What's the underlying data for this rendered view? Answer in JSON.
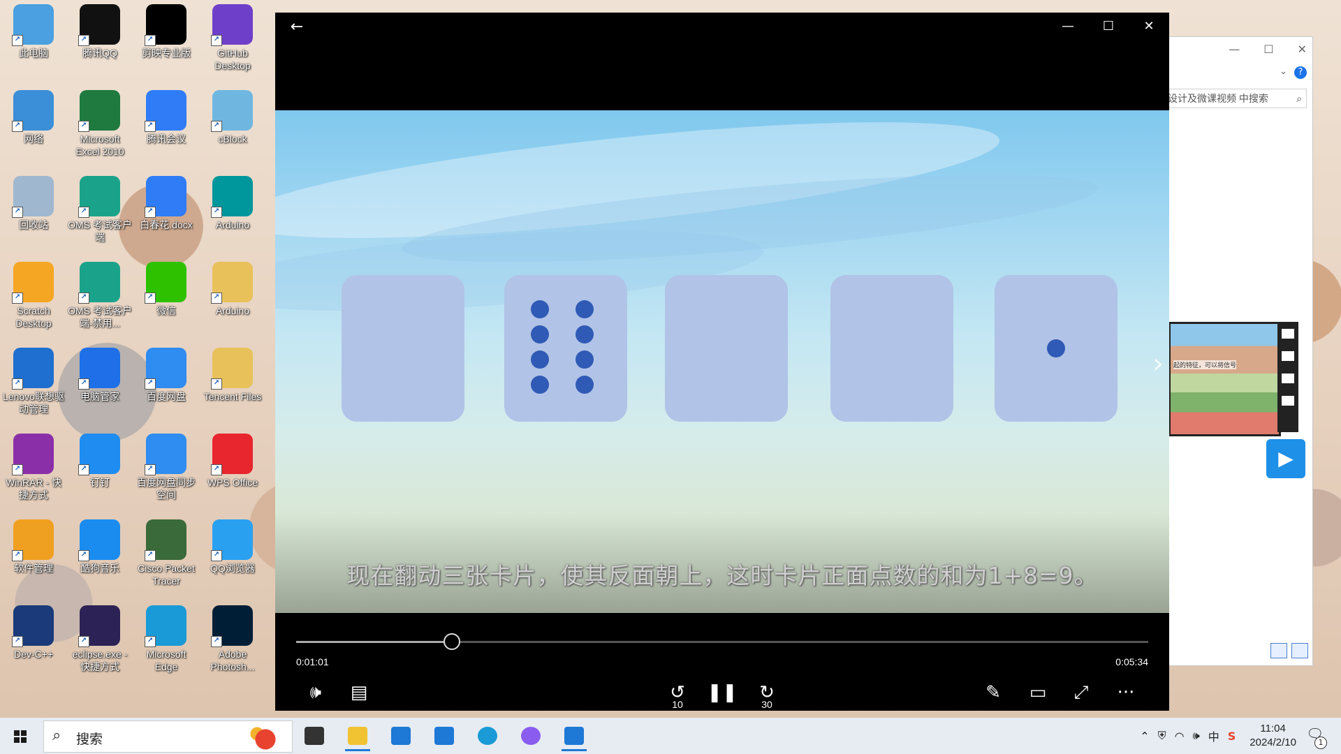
{
  "desktop": {
    "icons": [
      {
        "label": "此电脑",
        "icon": "computer-icon",
        "color": "#4aa0e0"
      },
      {
        "label": "腾讯QQ",
        "icon": "qq-icon",
        "color": "#111111"
      },
      {
        "label": "剪映专业版",
        "icon": "capcut-icon",
        "color": "#000000"
      },
      {
        "label": "GitHub Desktop",
        "icon": "github-icon",
        "color": "#6e40c9"
      },
      {
        "label": "网络",
        "icon": "network-icon",
        "color": "#3a8fd8"
      },
      {
        "label": "Microsoft Excel 2010",
        "icon": "excel-icon",
        "color": "#1f7a3f"
      },
      {
        "label": "腾讯会议",
        "icon": "tencent-meeting-icon",
        "color": "#2f7cf6"
      },
      {
        "label": "cBlock",
        "icon": "cblock-icon",
        "color": "#6fb7e0"
      },
      {
        "label": "回收站",
        "icon": "recycle-bin-icon",
        "color": "#9fb8d0"
      },
      {
        "label": "OMS 考试客户端",
        "icon": "oms-icon",
        "color": "#1aa38a"
      },
      {
        "label": "白春花.docx",
        "icon": "wps-doc-icon",
        "color": "#2f7cf6"
      },
      {
        "label": "Arduino",
        "icon": "arduino-icon",
        "color": "#00979c"
      },
      {
        "label": "Scratch Desktop",
        "icon": "scratch-icon",
        "color": "#f5a623"
      },
      {
        "label": "OMS 考试客户端-禁用...",
        "icon": "oms-icon",
        "color": "#1aa38a"
      },
      {
        "label": "微信",
        "icon": "wechat-icon",
        "color": "#2dc100"
      },
      {
        "label": "Arduino",
        "icon": "folder-icon",
        "color": "#e8c15a"
      },
      {
        "label": "Lenovo联想驱动管理",
        "icon": "lenovo-driver-icon",
        "color": "#1e6fd0"
      },
      {
        "label": "电脑管家",
        "icon": "pc-manager-icon",
        "color": "#1e6fe8"
      },
      {
        "label": "百度网盘",
        "icon": "baidu-netdisk-icon",
        "color": "#2f8cf0"
      },
      {
        "label": "Tencent Files",
        "icon": "folder-icon",
        "color": "#e8c15a"
      },
      {
        "label": "WinRAR - 快捷方式",
        "icon": "winrar-icon",
        "color": "#8b2fa8"
      },
      {
        "label": "钉钉",
        "icon": "dingtalk-icon",
        "color": "#1e8cf0"
      },
      {
        "label": "百度网盘同步空间",
        "icon": "baidu-sync-icon",
        "color": "#2f8cf0"
      },
      {
        "label": "WPS Office",
        "icon": "wps-icon",
        "color": "#e8262e"
      },
      {
        "label": "软件管理",
        "icon": "software-manager-icon",
        "color": "#f0a020"
      },
      {
        "label": "酷狗音乐",
        "icon": "kugou-icon",
        "color": "#1a8cf0"
      },
      {
        "label": "Cisco Packet Tracer",
        "icon": "cisco-icon",
        "color": "#3a6a3a"
      },
      {
        "label": "QQ浏览器",
        "icon": "qq-browser-icon",
        "color": "#2aa0f0"
      },
      {
        "label": "Dev-C++",
        "icon": "devcpp-icon",
        "color": "#1a3a7a"
      },
      {
        "label": "eclipse.exe - 快捷方式",
        "icon": "eclipse-icon",
        "color": "#2c2255"
      },
      {
        "label": "Microsoft Edge",
        "icon": "edge-icon",
        "color": "#1a9ad6"
      },
      {
        "label": "Adobe Photosh...",
        "icon": "photoshop-icon",
        "color": "#001e36"
      }
    ]
  },
  "explorer": {
    "search_placeholder": "设计及微课视频 中搜索",
    "thumb_caption": "起的特征，可以将信号"
  },
  "player": {
    "back_glyph": "←",
    "minimize_glyph": "—",
    "maximize_glyph": "☐",
    "close_glyph": "✕",
    "subtitle": "现在翻动三张卡片，使其反面朝上，这时卡片正面点数的和为1+8=9。",
    "current_time": "0:01:01",
    "total_time": "0:05:34",
    "progress_fraction": 0.1826,
    "cards": [
      {
        "dots": 0
      },
      {
        "dots": 8
      },
      {
        "dots": 0
      },
      {
        "dots": 0
      },
      {
        "dots": 1
      }
    ],
    "controls": {
      "volume": "volume-icon",
      "captions": "captions-icon",
      "skip_back": "10",
      "pause": "pause-icon",
      "skip_forward": "30",
      "edit": "pencil-icon",
      "mini_view": "mini-view-icon",
      "fullscreen": "fullscreen-icon",
      "more": "···"
    }
  },
  "taskbar": {
    "search_placeholder": "搜索",
    "pinned": [
      {
        "icon": "task-view-icon",
        "color": "#333333"
      },
      {
        "icon": "file-explorer-icon",
        "color": "#f1c232"
      },
      {
        "icon": "microsoft-store-icon",
        "color": "#1e78d6"
      },
      {
        "icon": "mail-icon",
        "color": "#1e78d6"
      },
      {
        "icon": "edge-icon",
        "color": "#1a9ad6"
      },
      {
        "icon": "copilot-icon",
        "color": "#8a5cf0"
      },
      {
        "icon": "movies-tv-icon",
        "color": "#1e78d6"
      }
    ],
    "tray": {
      "ime": "中",
      "time": "11:04",
      "date": "2024/2/10",
      "notifications": "1"
    }
  }
}
